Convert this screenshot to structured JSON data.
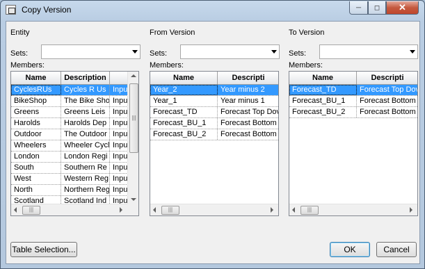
{
  "window": {
    "title": "Copy Version"
  },
  "entity": {
    "title": "Entity",
    "sets_label": "Sets:",
    "sets_value": "",
    "members_label": "Members:",
    "columns": [
      "Name",
      "Description",
      ""
    ],
    "rows": [
      [
        "CyclesRUs",
        "Cycles R Us",
        "Input"
      ],
      [
        "BikeShop",
        "The Bike Sho",
        "Input"
      ],
      [
        "Greens",
        "Greens Leis",
        "Input"
      ],
      [
        "Harolds",
        "Harolds Dep",
        "Input"
      ],
      [
        "Outdoor",
        "The Outdoor",
        "Input"
      ],
      [
        "Wheelers",
        "Wheeler Cycl",
        "Input"
      ],
      [
        "London",
        "London Regi",
        "Input"
      ],
      [
        "South",
        "Southern Re",
        "Input"
      ],
      [
        "West",
        "Western Reg",
        "Input"
      ],
      [
        "North",
        "Northern Reg",
        "Input"
      ],
      [
        "Scotland",
        "Scotland Ind",
        "Input"
      ]
    ]
  },
  "from_version": {
    "title": "From Version",
    "sets_label": "Sets:",
    "sets_value": "",
    "members_label": "Members:",
    "columns": [
      "Name",
      "Descripti"
    ],
    "rows": [
      [
        "Year_2",
        "Year minus 2"
      ],
      [
        "Year_1",
        "Year minus 1"
      ],
      [
        "Forecast_TD",
        "Forecast Top Dov"
      ],
      [
        "Forecast_BU_1",
        "Forecast Bottom"
      ],
      [
        "Forecast_BU_2",
        "Forecast Bottom"
      ]
    ]
  },
  "to_version": {
    "title": "To Version",
    "sets_label": "Sets:",
    "sets_value": "",
    "members_label": "Members:",
    "columns": [
      "Name",
      "Descripti"
    ],
    "rows": [
      [
        "Forecast_TD",
        "Forecast Top Dov"
      ],
      [
        "Forecast_BU_1",
        "Forecast Bottom"
      ],
      [
        "Forecast_BU_2",
        "Forecast Bottom"
      ]
    ]
  },
  "buttons": {
    "table_selection": "Table Selection...",
    "ok": "OK",
    "cancel": "Cancel"
  },
  "scroll_grip": "|||",
  "selection_color": "#3399ff"
}
